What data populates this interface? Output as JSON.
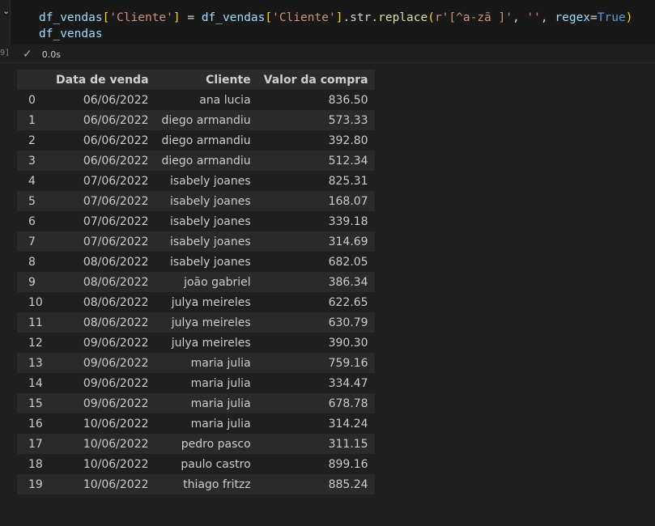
{
  "cell": {
    "execution_count_label": "9]",
    "code_line1": {
      "a": "df_vendas",
      "b": "[",
      "c": "'Cliente'",
      "d": "]",
      "e": " = ",
      "f": "df_vendas",
      "g": "[",
      "h": "'Cliente'",
      "i": "]",
      "j": ".str.",
      "k": "replace",
      "l": "(",
      "m": "r'[^a-zã ]'",
      "n": ", ",
      "o": "''",
      "p": ", ",
      "q": "regex",
      "r": "=",
      "s": "True",
      "t": ")"
    },
    "code_line2": "df_vendas",
    "status_time": "0.0s"
  },
  "table": {
    "columns": [
      "",
      "Data de venda",
      "Cliente",
      "Valor da compra"
    ],
    "rows": [
      [
        "0",
        "06/06/2022",
        "ana lucia",
        "836.50"
      ],
      [
        "1",
        "06/06/2022",
        "diego armandiu",
        "573.33"
      ],
      [
        "2",
        "06/06/2022",
        "diego armandiu",
        "392.80"
      ],
      [
        "3",
        "06/06/2022",
        "diego armandiu",
        "512.34"
      ],
      [
        "4",
        "07/06/2022",
        "isabely joanes",
        "825.31"
      ],
      [
        "5",
        "07/06/2022",
        "isabely joanes",
        "168.07"
      ],
      [
        "6",
        "07/06/2022",
        "isabely joanes",
        "339.18"
      ],
      [
        "7",
        "07/06/2022",
        "isabely joanes",
        "314.69"
      ],
      [
        "8",
        "08/06/2022",
        "isabely joanes",
        "682.05"
      ],
      [
        "9",
        "08/06/2022",
        "joão gabriel",
        "386.34"
      ],
      [
        "10",
        "08/06/2022",
        "julya meireles",
        "622.65"
      ],
      [
        "11",
        "08/06/2022",
        "julya meireles",
        "630.79"
      ],
      [
        "12",
        "09/06/2022",
        "julya meireles",
        "390.30"
      ],
      [
        "13",
        "09/06/2022",
        "maria julia",
        "759.16"
      ],
      [
        "14",
        "09/06/2022",
        "maria julia",
        "334.47"
      ],
      [
        "15",
        "09/06/2022",
        "maria julia",
        "678.78"
      ],
      [
        "16",
        "10/06/2022",
        "maria julia",
        "314.24"
      ],
      [
        "17",
        "10/06/2022",
        "pedro pasco",
        "311.15"
      ],
      [
        "18",
        "10/06/2022",
        "paulo castro",
        "899.16"
      ],
      [
        "19",
        "10/06/2022",
        "thiago fritzz",
        "885.24"
      ]
    ]
  },
  "colors": {
    "background": "#1f1f1f",
    "check": "#89d185",
    "string": "#ce9178",
    "keyword": "#569cd6"
  },
  "icons": {
    "collapse": "chevron-down-icon",
    "status": "check-icon"
  }
}
